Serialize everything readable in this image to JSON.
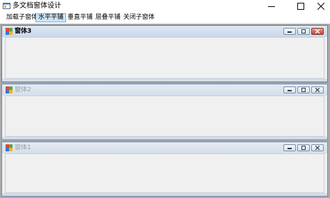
{
  "window": {
    "title": "多文档窗体设计"
  },
  "menu": {
    "items": [
      {
        "label": "加载子窗体",
        "selected": false
      },
      {
        "label": "水平平铺",
        "selected": true
      },
      {
        "label": "垂直平铺",
        "selected": false
      },
      {
        "label": "层叠平铺",
        "selected": false
      },
      {
        "label": "关闭子窗体",
        "selected": false
      }
    ]
  },
  "children": [
    {
      "title": "窗体3",
      "active": true
    },
    {
      "title": "窗体2",
      "active": false
    },
    {
      "title": "窗体1",
      "active": false
    }
  ],
  "colors": {
    "mdi_background": "#a9a9a9",
    "child_title_active": "#c9d8ea",
    "close_active": "#c5412b",
    "menu_selected": "#cce4f7"
  },
  "icons": [
    "app-icon",
    "minimize-icon",
    "maximize-icon",
    "close-icon",
    "form-icon",
    "restore-icon"
  ]
}
